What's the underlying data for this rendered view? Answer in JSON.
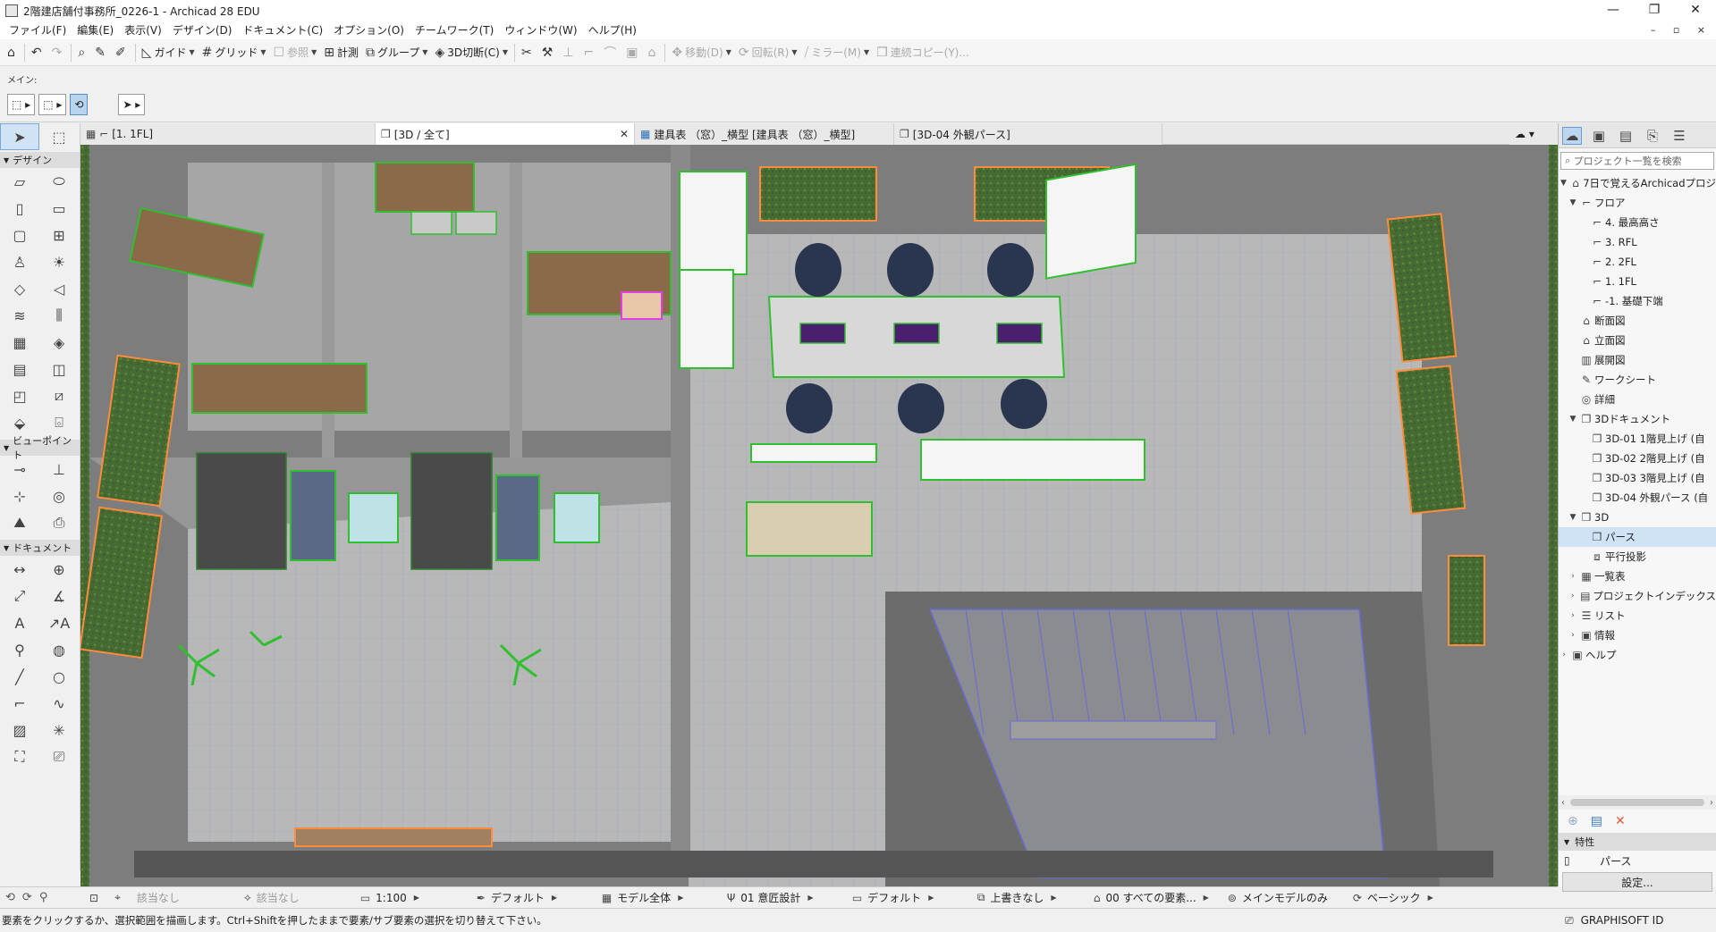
{
  "window": {
    "title": "2階建店舗付事務所_0226-1 - Archicad 28 EDU",
    "min": "—",
    "max": "❐",
    "close": "✕"
  },
  "menu": [
    "ファイル(F)",
    "編集(E)",
    "表示(V)",
    "デザイン(D)",
    "ドキュメント(C)",
    "オプション(O)",
    "チームワーク(T)",
    "ウィンドウ(W)",
    "ヘルプ(H)"
  ],
  "menu_right": "– ▫ ×",
  "toolbar": {
    "guide": "ガイド",
    "grid": "グリッド",
    "ref": "参照",
    "measure": "計測",
    "group": "グループ",
    "section3d": "3D切断(C)",
    "move": "移動(D)",
    "rotate": "回転(R)",
    "mirror": "ミラー(M)",
    "multiply": "連続コピー(Y)..."
  },
  "infobox": {
    "label": "メイン:"
  },
  "tabs": [
    {
      "label": "[1. 1FL]"
    },
    {
      "label": "[3D / 全て]"
    },
    {
      "label": "建具表 （窓）_横型 [建具表 （窓）_横型]"
    },
    {
      "label": "[3D-04 外観パース]"
    }
  ],
  "toolbox": {
    "design": "デザイン",
    "viewpoint": "ビューポイント",
    "document": "ドキュメント"
  },
  "navigator": {
    "search_placeholder": "プロジェクト一覧を検索",
    "root": "7日で覚えるArchicadプロジ",
    "floors": "フロア",
    "floor_items": [
      "4. 最高高さ",
      "3. RFL",
      "2. 2FL",
      "1. 1FL",
      "-1. 基礎下端"
    ],
    "sections": "断面図",
    "elevations": "立面図",
    "interior": "展開図",
    "worksheets": "ワークシート",
    "details": "詳細",
    "doc3d": "3Dドキュメント",
    "doc3d_items": [
      "3D-01 1階見上げ (自",
      "3D-02 2階見上げ (自",
      "3D-03 3階見上げ (自",
      "3D-04 外観パース (自"
    ],
    "threeD": "3D",
    "perspective": "パース",
    "axon": "平行投影",
    "schedules": "一覧表",
    "index": "プロジェクトインデックス",
    "lists": "リスト",
    "info": "情報",
    "help": "ヘルプ"
  },
  "properties": {
    "header": "特性",
    "value": "パース",
    "settings": "設定..."
  },
  "quickoptions": {
    "na1": "該当なし",
    "na2": "該当なし",
    "scale": "1:100",
    "pen": "デフォルト",
    "model": "モデル全体",
    "layer": "01 意匠設計",
    "struct": "デフォルト",
    "override": "上書きなし",
    "reno": "00 すべての要素...",
    "mvo": "メインモデルのみ",
    "view": "ベーシック"
  },
  "status": "要素をクリックするか、選択範囲を描画します。Ctrl+Shiftを押したままで要素/サブ要素の選択を切り替えて下さい。",
  "graphisoft_id": "GRAPHISOFT ID",
  "colors": {
    "selection": "#2fbf2f",
    "wall": "#9a9a9a",
    "grass": "#4a6b34",
    "floor": "#b9b9b9",
    "window": "#ff8c3a"
  }
}
